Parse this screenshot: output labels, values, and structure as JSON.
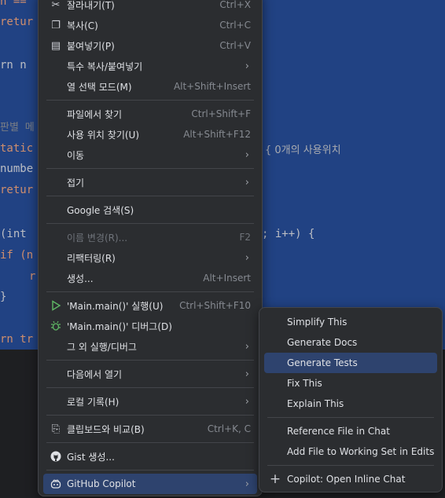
{
  "editor": {
    "code_fragments": [
      "n ==",
      "retur",
      "rn n",
      "판별 메",
      "tatic",
      "numbe",
      "retur",
      "(int ",
      "if (n",
      "r",
      "}",
      "rn tr",
      "; i++) {"
    ],
    "inlay_hint": "{  0개의 사용위치"
  },
  "context_menu": {
    "items": [
      {
        "label": "잘라내기(T)",
        "shortcut": "Ctrl+X",
        "icon": "scissors-icon"
      },
      {
        "label": "복사(C)",
        "shortcut": "Ctrl+C",
        "icon": "copy-icon"
      },
      {
        "label": "붙여넣기(P)",
        "shortcut": "Ctrl+V",
        "icon": "paste-icon"
      },
      {
        "label": "특수 복사/붙여넣기",
        "submenu": true
      },
      {
        "label": "열 선택 모드(M)",
        "shortcut": "Alt+Shift+Insert"
      },
      {
        "label": "파일에서 찾기",
        "shortcut": "Ctrl+Shift+F"
      },
      {
        "label": "사용 위치 찾기(U)",
        "shortcut": "Alt+Shift+F12"
      },
      {
        "label": "이동",
        "submenu": true
      },
      {
        "label": "접기",
        "submenu": true
      },
      {
        "label": "Google 검색(S)"
      },
      {
        "label": "이름 변경(R)...",
        "shortcut": "F2",
        "disabled": true
      },
      {
        "label": "리팩터링(R)",
        "submenu": true
      },
      {
        "label": "생성...",
        "shortcut": "Alt+Insert"
      },
      {
        "label": "'Main.main()' 실행(U)",
        "shortcut": "Ctrl+Shift+F10",
        "icon": "run-icon"
      },
      {
        "label": "'Main.main()' 디버그(D)",
        "icon": "debug-icon"
      },
      {
        "label": "그 외 실행/디버그",
        "submenu": true
      },
      {
        "label": "다음에서 열기",
        "submenu": true
      },
      {
        "label": "로컬 기록(H)",
        "submenu": true
      },
      {
        "label": "클립보드와 비교(B)",
        "shortcut": "Ctrl+K, C",
        "icon": "compare-clipboard-icon"
      },
      {
        "label": "Gist 생성...",
        "icon": "github-icon"
      },
      {
        "label": "GitHub Copilot",
        "submenu": true,
        "icon": "copilot-icon",
        "highlighted": true
      }
    ],
    "chevron": "›"
  },
  "copilot_submenu": {
    "items": [
      {
        "label": "Simplify This"
      },
      {
        "label": "Generate Docs"
      },
      {
        "label": "Generate Tests",
        "highlighted": true
      },
      {
        "label": "Fix This"
      },
      {
        "label": "Explain This"
      },
      {
        "label": "Reference File in Chat"
      },
      {
        "label": "Add File to Working Set in Edits"
      },
      {
        "label": "Copilot: Open Inline Chat",
        "icon": "plus-icon"
      }
    ]
  },
  "colors": {
    "selection": "#214283",
    "menu_bg": "#2b2d30",
    "highlight": "#2e436e",
    "run_green": "#5fb865"
  }
}
